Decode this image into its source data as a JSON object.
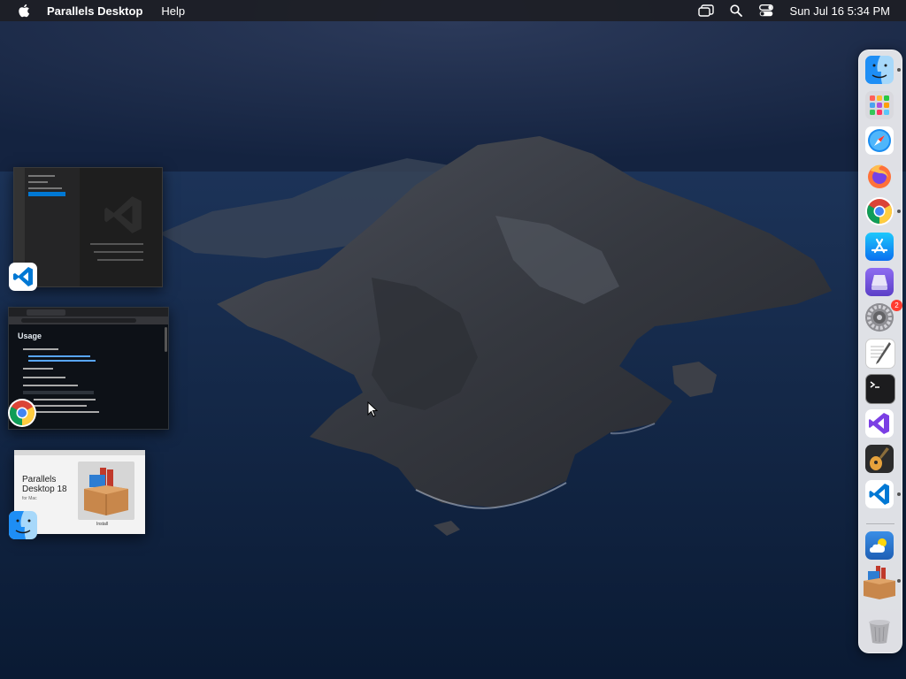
{
  "menubar": {
    "app_name": "Parallels Desktop",
    "menus": [
      "Help"
    ],
    "clock": "Sun Jul 16  5:34 PM"
  },
  "windows": {
    "chrome_preview_heading": "Usage",
    "parallels_preview": {
      "product_line1": "Parallels",
      "product_line2": "Desktop 18",
      "product_sub": "for Mac",
      "button": "Install"
    }
  },
  "dock": {
    "items": [
      {
        "name": "Finder",
        "icon": "finder-icon",
        "running": true
      },
      {
        "name": "Launchpad",
        "icon": "launchpad-icon",
        "running": false
      },
      {
        "name": "Safari",
        "icon": "safari-icon",
        "running": false
      },
      {
        "name": "Firefox",
        "icon": "firefox-icon",
        "running": false
      },
      {
        "name": "Google Chrome",
        "icon": "chrome-icon",
        "running": true
      },
      {
        "name": "App Store",
        "icon": "app-store-icon",
        "running": false
      },
      {
        "name": "Disk Utility",
        "icon": "disk-icon",
        "running": false
      },
      {
        "name": "System Settings",
        "icon": "system-settings-icon",
        "running": false,
        "badge": "2"
      },
      {
        "name": "TextEdit",
        "icon": "textedit-icon",
        "running": false
      },
      {
        "name": "Terminal",
        "icon": "terminal-icon",
        "running": false
      },
      {
        "name": "Visual Studio",
        "icon": "visual-studio-icon",
        "running": false
      },
      {
        "name": "GarageBand",
        "icon": "garageband-icon",
        "running": false
      },
      {
        "name": "Visual Studio Code",
        "icon": "vscode-icon",
        "running": true
      },
      {
        "name": "Weather",
        "icon": "weather-icon",
        "running": false
      },
      {
        "name": "Parallels Desktop Installer",
        "icon": "parallels-box-icon",
        "running": true
      },
      {
        "name": "Trash",
        "icon": "trash-icon",
        "running": false
      }
    ]
  },
  "colors": {
    "menubar_bg": "#1e2026",
    "dock_bg": "#f5f5f7",
    "vscode_blue": "#0078d4",
    "badge_red": "#ff3b30"
  }
}
